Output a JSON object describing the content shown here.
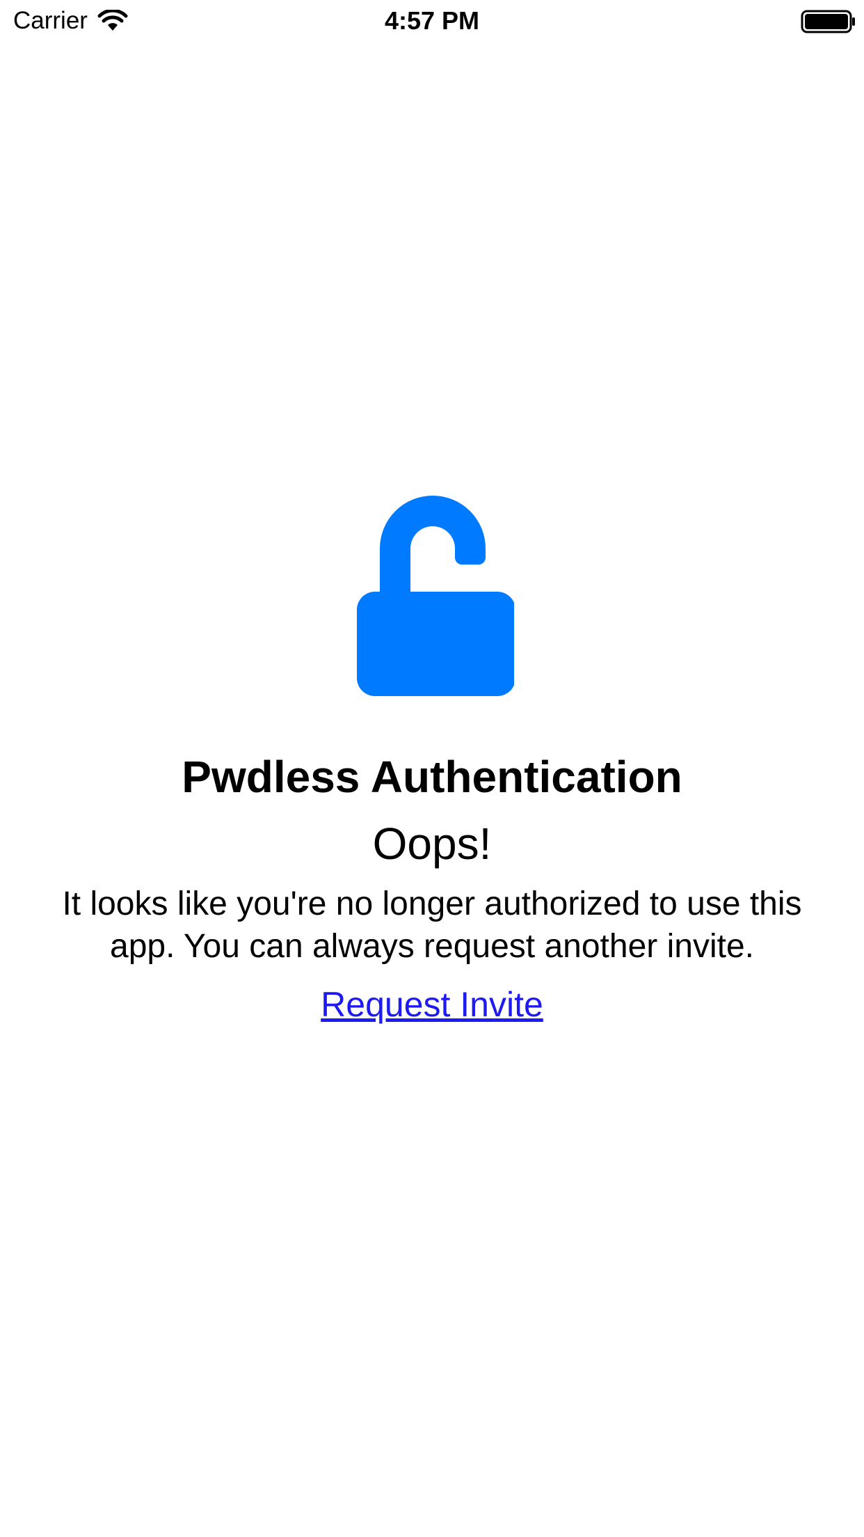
{
  "status_bar": {
    "carrier": "Carrier",
    "time": "4:57 PM"
  },
  "icons": {
    "wifi": "wifi-icon",
    "battery": "battery-full-icon",
    "lock": "unlocked-padlock-icon"
  },
  "colors": {
    "accent": "#007aff",
    "link": "#1d1af2",
    "text": "#000000",
    "background": "#ffffff"
  },
  "main": {
    "title": "Pwdless Authentication",
    "subtitle": "Oops!",
    "message": "It looks like you're no longer authorized to use this app.  You can always request another invite.",
    "link_label": "Request Invite"
  }
}
